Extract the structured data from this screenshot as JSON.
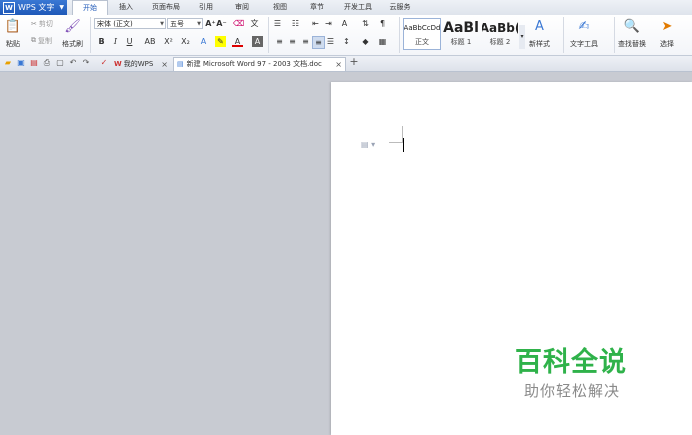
{
  "app": {
    "name": "WPS 文字",
    "logo_letter": "W"
  },
  "menu": {
    "tabs": [
      "开始",
      "插入",
      "页面布局",
      "引用",
      "审阅",
      "视图",
      "章节",
      "开发工具",
      "云服务"
    ],
    "active_index": 0
  },
  "ribbon": {
    "paste": "粘贴",
    "cut": "剪切",
    "copy": "复制",
    "format_painter": "格式刷",
    "font_name": "宋体 (正文)",
    "font_size": "五号",
    "styles": [
      {
        "sample": "AaBbCcDd",
        "name": "正文"
      },
      {
        "sample": "AaBl",
        "name": "标题 1"
      },
      {
        "sample": "AaBb(",
        "name": "标题 2"
      }
    ],
    "new_style": "新样式",
    "text_tools": "文字工具",
    "find_replace": "查找替换",
    "select": "选择"
  },
  "doc_tabs": [
    {
      "label": "我的WPS",
      "active": false
    },
    {
      "label": "新建 Microsoft Word 97 - 2003 文档.doc",
      "active": true
    }
  ],
  "add_tab": "+",
  "watermark": {
    "title": "百科全说",
    "subtitle": "助你轻松解决"
  },
  "colors": {
    "accent": "#1f59b8",
    "watermark_green": "#2fb24a",
    "workspace": "#c8cbd2"
  }
}
